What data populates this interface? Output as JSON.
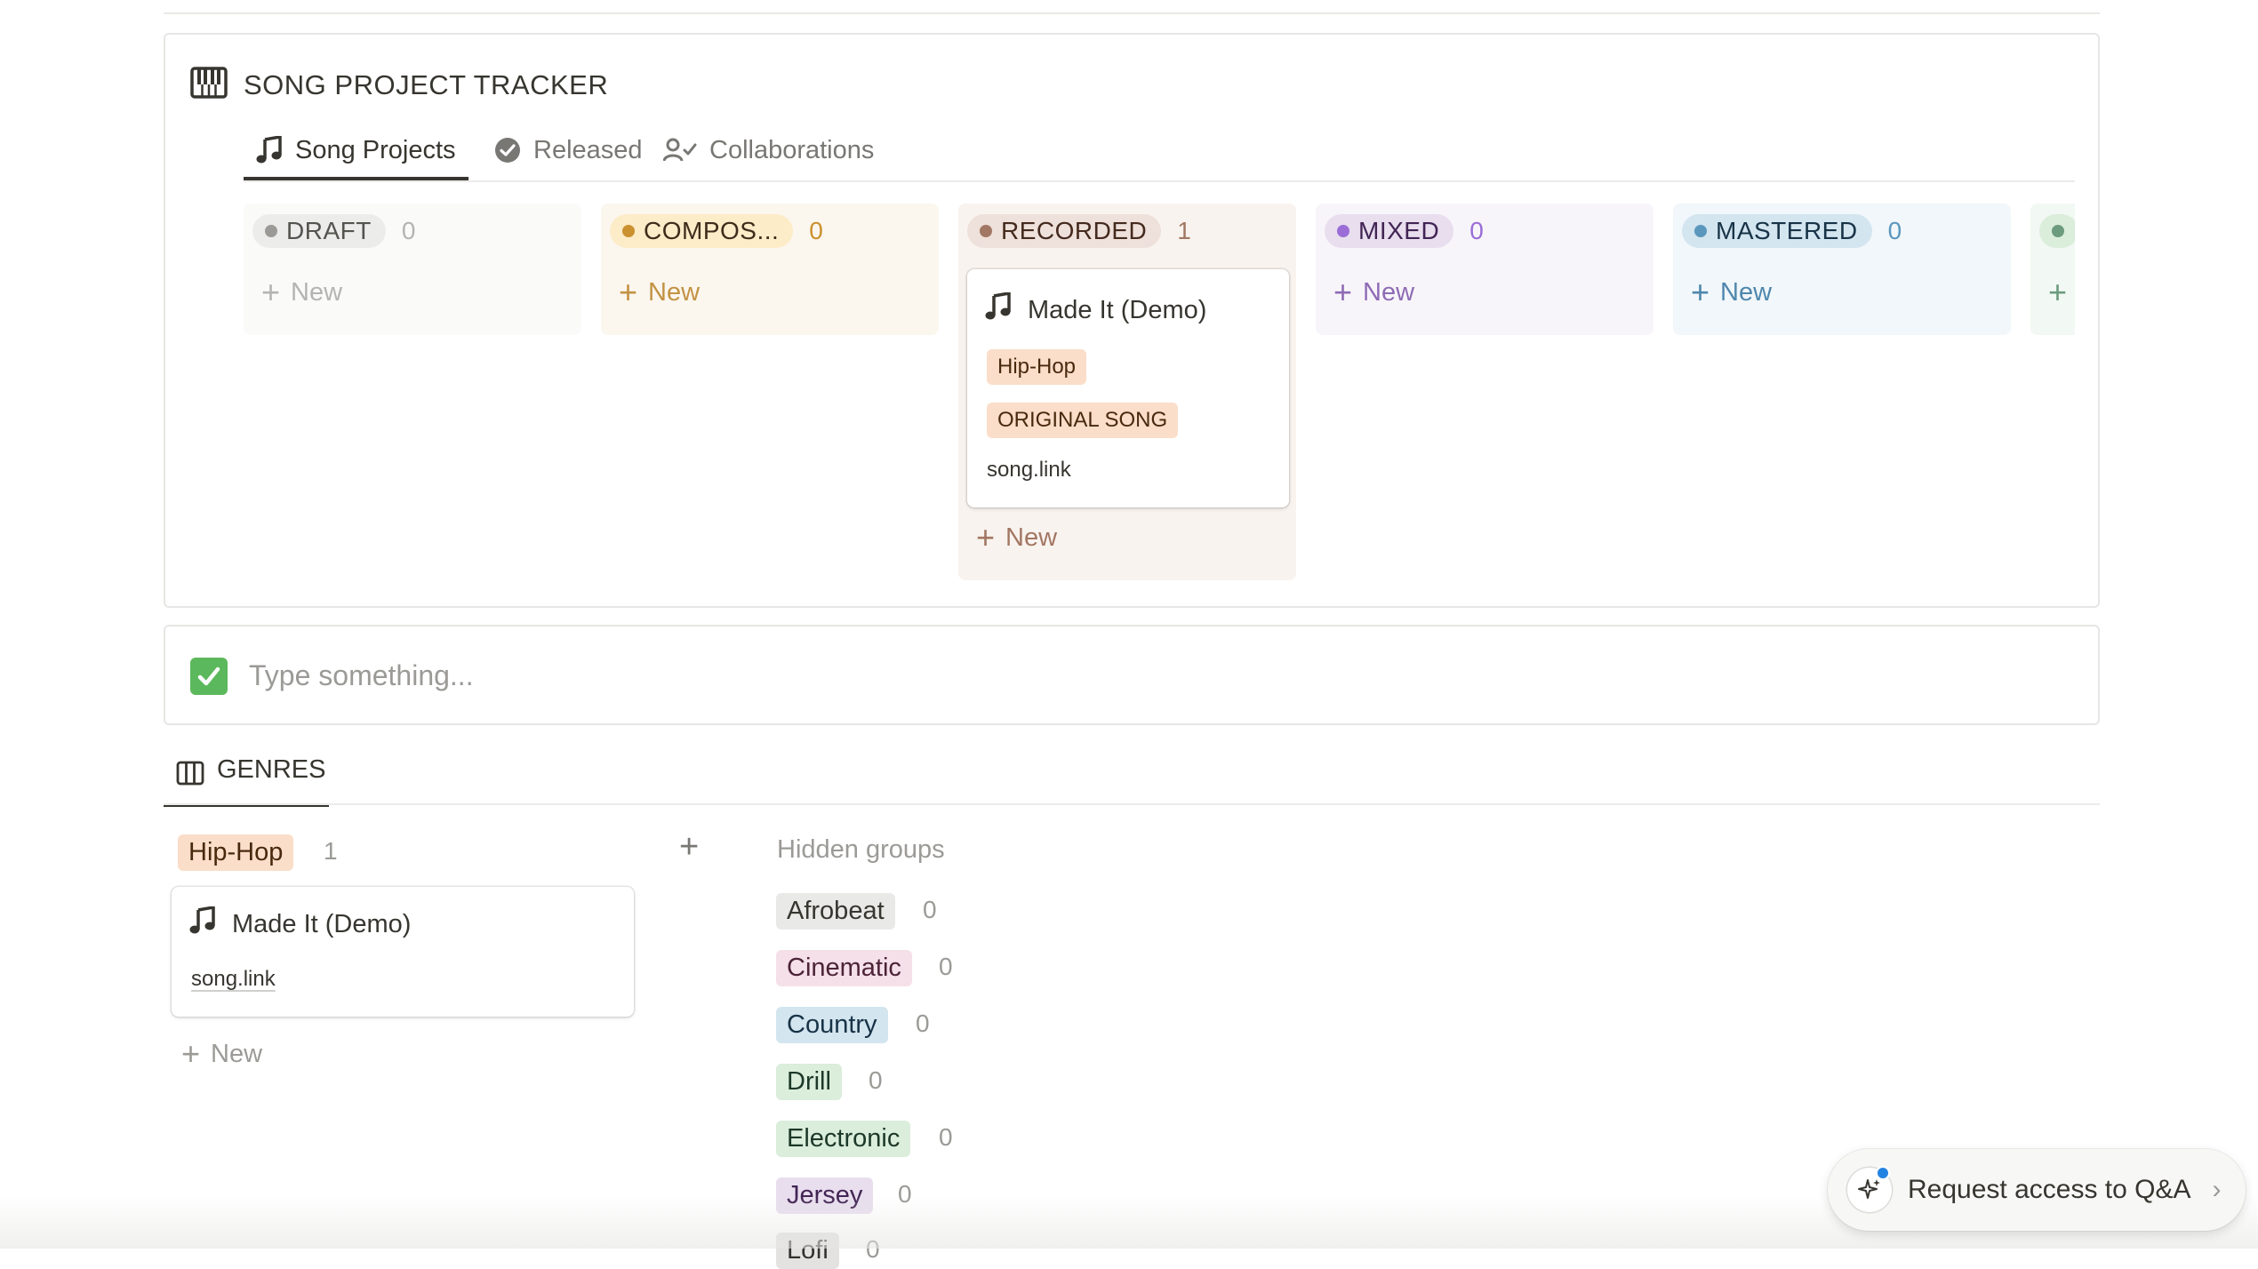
{
  "tracker": {
    "title": "SONG PROJECT TRACKER",
    "tabs": [
      {
        "label": "Song Projects",
        "icon": "music-note-icon",
        "active": true
      },
      {
        "label": "Released",
        "icon": "check-circle-icon",
        "active": false
      },
      {
        "label": "Collaborations",
        "icon": "person-check-icon",
        "active": false
      }
    ],
    "columns": [
      {
        "status": "DRAFT",
        "count": "0",
        "new_label": "New"
      },
      {
        "status": "COMPOS...",
        "count": "0",
        "new_label": "New"
      },
      {
        "status": "RECORDED",
        "count": "1",
        "new_label": "New"
      },
      {
        "status": "MIXED",
        "count": "0",
        "new_label": "New"
      },
      {
        "status": "MASTERED",
        "count": "0",
        "new_label": "New"
      }
    ],
    "recorded_card": {
      "title": "Made It (Demo)",
      "genre_tag": "Hip-Hop",
      "type_tag": "ORIGINAL SONG",
      "link": "song.link"
    }
  },
  "input": {
    "placeholder": "Type something..."
  },
  "genres": {
    "tab_label": "GENRES",
    "group": {
      "label": "Hip-Hop",
      "count": "1"
    },
    "card": {
      "title": "Made It (Demo)",
      "link": "song.link"
    },
    "new_label": "New",
    "hidden_groups_label": "Hidden groups",
    "hidden_groups": [
      {
        "label": "Afrobeat",
        "count": "0",
        "color": "#e9e9e7"
      },
      {
        "label": "Cinematic",
        "count": "0",
        "color": "#f5e0e9"
      },
      {
        "label": "Country",
        "count": "0",
        "color": "#d3e5ef"
      },
      {
        "label": "Drill",
        "count": "0",
        "color": "#dbeddb"
      },
      {
        "label": "Electronic",
        "count": "0",
        "color": "#dbeddb"
      },
      {
        "label": "Jersey",
        "count": "0",
        "color": "#e8deee"
      },
      {
        "label": "Lofi",
        "count": "0",
        "color": "#e3e2e0"
      }
    ]
  },
  "qa_button": {
    "label": "Request access to Q&A"
  }
}
